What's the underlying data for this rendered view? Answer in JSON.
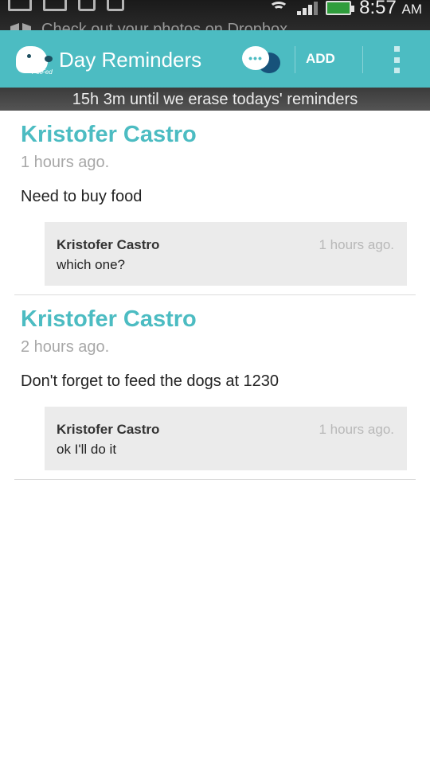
{
  "status_bar": {
    "notification_ticker": "Check out your photos on Dropbox",
    "time": "8:57",
    "ampm": "AM",
    "icons": [
      "gallery-icon",
      "gmail-icon",
      "usb-icon",
      "debug-icon",
      "dropbox-icon",
      "wifi-icon",
      "signal-icon",
      "battery-charging-icon"
    ]
  },
  "action_bar": {
    "title": "Day Reminders",
    "logo_text": "PetFed",
    "add_label": "ADD",
    "accent_color": "#4cbcc2"
  },
  "banner": {
    "text": "15h 3m until we erase todays' reminders"
  },
  "reminders": [
    {
      "author": "Kristofer Castro",
      "time": "1 hours ago.",
      "text": "Need to buy food",
      "comment": {
        "author": "Kristofer Castro",
        "time": "1 hours ago.",
        "text": "which one?"
      }
    },
    {
      "author": "Kristofer Castro",
      "time": "2 hours ago.",
      "text": "Don't forget to feed the dogs at 1230",
      "comment": {
        "author": "Kristofer Castro",
        "time": "1 hours ago.",
        "text": "ok I'll do it"
      }
    }
  ]
}
